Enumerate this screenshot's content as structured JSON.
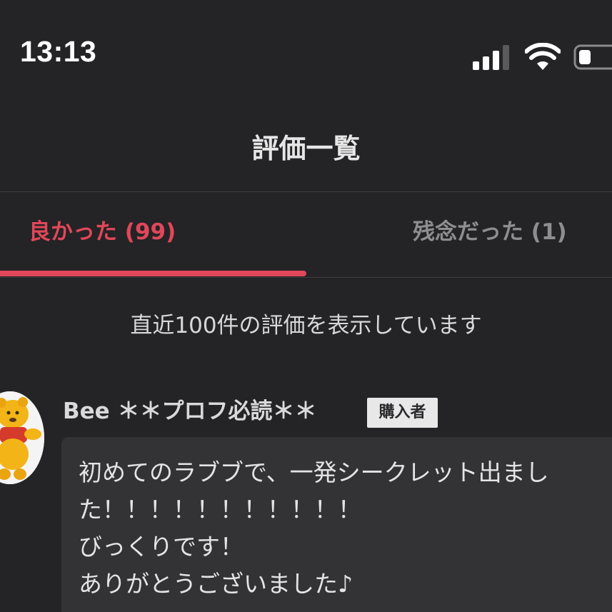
{
  "status_bar": {
    "time": "13:13",
    "icons": [
      "signal-icon",
      "wifi-icon",
      "battery-icon"
    ]
  },
  "header": {
    "title": "評価一覧"
  },
  "tabs": [
    {
      "label": "良かった (99)",
      "active": true
    },
    {
      "label": "残念だった (1)",
      "active": false
    }
  ],
  "notice": "直近100件の評価を表示しています",
  "reviews": [
    {
      "name": "Bee ＊＊プロフ必読＊＊",
      "badge": "購入者",
      "comment_lines": [
        "初めてのラブブで、一発シークレット出まし",
        "た！！！！！！！！！！！",
        "びっくりです！",
        "ありがとうございました♪"
      ]
    }
  ],
  "colors": {
    "background": "#242325",
    "accent": "#e0475a",
    "inactive_tab": "#8e8d91",
    "bubble": "#333235"
  }
}
